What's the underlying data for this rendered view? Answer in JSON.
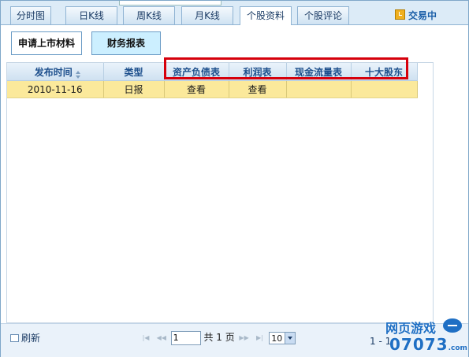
{
  "tabs": [
    {
      "label": "分时图",
      "active": false
    },
    {
      "label": "日K线",
      "active": false
    },
    {
      "label": "周K线",
      "active": false
    },
    {
      "label": "月K线",
      "active": false
    },
    {
      "label": "个股资料",
      "active": true
    },
    {
      "label": "个股评论",
      "active": false
    }
  ],
  "status": {
    "label": "交易中",
    "icon": "clock-icon"
  },
  "subnav": {
    "listing_materials": "申请上市材料",
    "financial_reports": "财务报表"
  },
  "table": {
    "columns": [
      "发布时间",
      "类型",
      "资产负债表",
      "利润表",
      "现金流量表",
      "十大股东"
    ],
    "rows": [
      {
        "date": "2010-11-16",
        "type": "日报",
        "balance_sheet": "查看",
        "income": "查看",
        "cash_flow": "",
        "top10": ""
      }
    ]
  },
  "footer": {
    "refresh_label": "刷新",
    "page_value": "1",
    "total_pages": "共 1 页",
    "page_size": "10",
    "range_text": "1 - 1"
  },
  "watermark": {
    "top": "网页游戏",
    "num": "07073",
    "suffix": ".com"
  },
  "colors": {
    "header_text": "#1d4f8c",
    "row_highlight": "#fbe99b",
    "annotation_box": "#d6000c",
    "selected_button": "#ccefff"
  }
}
